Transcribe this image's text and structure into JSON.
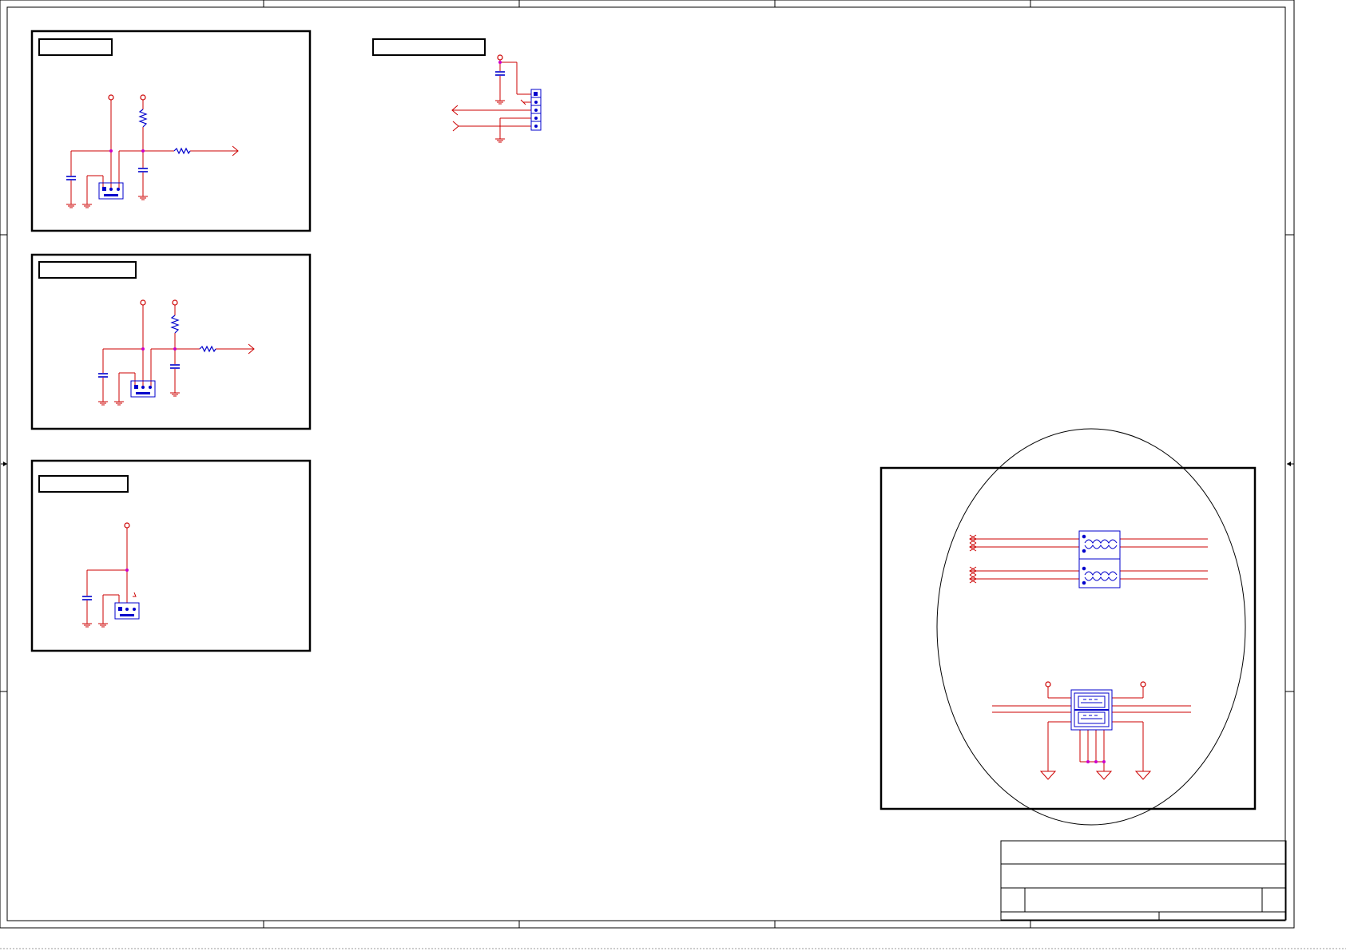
{
  "sheet": {
    "title_block": {
      "title": "",
      "document_number": "",
      "size": "",
      "rev": "",
      "date": "",
      "sheet_of": ""
    }
  },
  "blocks": {
    "block1": {
      "header": ""
    },
    "block2": {
      "header": ""
    },
    "block3": {
      "header": ""
    },
    "block4": {
      "header": ""
    }
  },
  "colors": {
    "wire": "#cc0000",
    "component": "#0000cc",
    "junction": "#cc00cc",
    "frame": "#000000"
  },
  "icons": [
    "ground-symbol",
    "power-symbol",
    "capacitor-symbol",
    "resistor-symbol",
    "connector-symbol",
    "port-arrow",
    "common-mode-choke",
    "usb-dual-connector"
  ]
}
